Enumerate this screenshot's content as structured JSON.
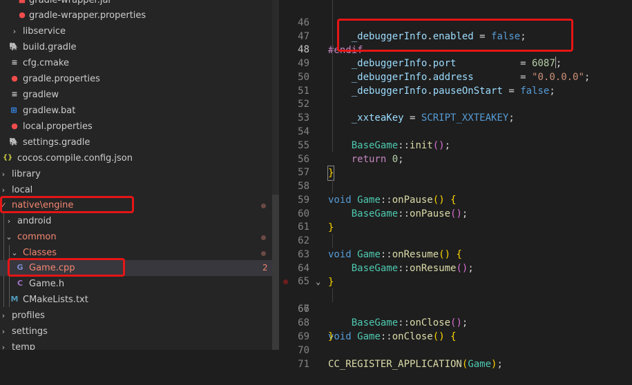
{
  "explorer": {
    "items": [
      {
        "label": "gradle-wrapper.jar",
        "icon": "ruby-file-icon"
      },
      {
        "label": "gradle-wrapper.properties",
        "icon": "properties-file-icon"
      },
      {
        "label": "libservice",
        "icon": "chevron-right-icon"
      },
      {
        "label": "build.gradle",
        "icon": "gradle-elephant-icon"
      },
      {
        "label": "cfg.cmake",
        "icon": "lines-file-icon"
      },
      {
        "label": "gradle.properties",
        "icon": "properties-file-icon"
      },
      {
        "label": "gradlew",
        "icon": "lines-file-icon"
      },
      {
        "label": "gradlew.bat",
        "icon": "windows-icon"
      },
      {
        "label": "local.properties",
        "icon": "properties-file-icon"
      },
      {
        "label": "settings.gradle",
        "icon": "gradle-elephant-icon"
      },
      {
        "label": "cocos.compile.config.json",
        "icon": "json-icon"
      },
      {
        "label": "library",
        "icon": "chevron-right-icon"
      },
      {
        "label": "local",
        "icon": "chevron-right-icon"
      },
      {
        "label": "native\\engine",
        "icon": "chevron-down-icon"
      },
      {
        "label": "android",
        "icon": "chevron-right-icon"
      },
      {
        "label": "common",
        "icon": "chevron-down-icon"
      },
      {
        "label": "Classes",
        "icon": "chevron-down-icon"
      },
      {
        "label": "Game.cpp",
        "icon": "cpp-file-icon",
        "badge": "2"
      },
      {
        "label": "Game.h",
        "icon": "c-header-icon"
      },
      {
        "label": "CMakeLists.txt",
        "icon": "cmake-icon"
      },
      {
        "label": "profiles",
        "icon": "chevron-right-icon"
      },
      {
        "label": "settings",
        "icon": "chevron-right-icon"
      },
      {
        "label": "temp",
        "icon": "chevron-right-icon"
      }
    ]
  },
  "editor": {
    "line_numbers": [
      "46",
      "47",
      "48",
      "49",
      "50",
      "51",
      "52",
      "53",
      "54",
      "55",
      "56",
      "57",
      "58",
      "59",
      "60",
      "61",
      "62",
      "63",
      "64",
      "65",
      "66",
      "67",
      "68",
      "69",
      "70",
      "71"
    ],
    "tokens": {
      "debuggerInfo": "_debuggerInfo",
      "enabled": "enabled",
      "port": "port",
      "address": "address",
      "pauseOnStart": "pauseOnStart",
      "false": "false",
      "endif": "#endif",
      "port_value": "6087",
      "address_value": "\"0.0.0.0\"",
      "xxteaKey": "_xxteaKey",
      "xxtea_macro": "SCRIPT_XXTEAKEY",
      "BaseGame": "BaseGame",
      "init": "init",
      "return": "return",
      "zero": "0",
      "void": "void",
      "Game": "Game",
      "onPause": "onPause",
      "onResume": "onResume",
      "onClose": "onClose",
      "register_macro": "CC_REGISTER_APPLICATION",
      "eq": " = ",
      "port_eq": "           = ",
      "addr_eq": "        = ",
      "dot": ".",
      "sep": "::",
      "semi": ";",
      "comma": ",",
      "lp": "(",
      "rp": ")",
      "lb": "{",
      "rb": "}",
      "sp": " "
    },
    "colors": {
      "highlight_box": "#e61515",
      "background": "#1e1e1e"
    }
  }
}
